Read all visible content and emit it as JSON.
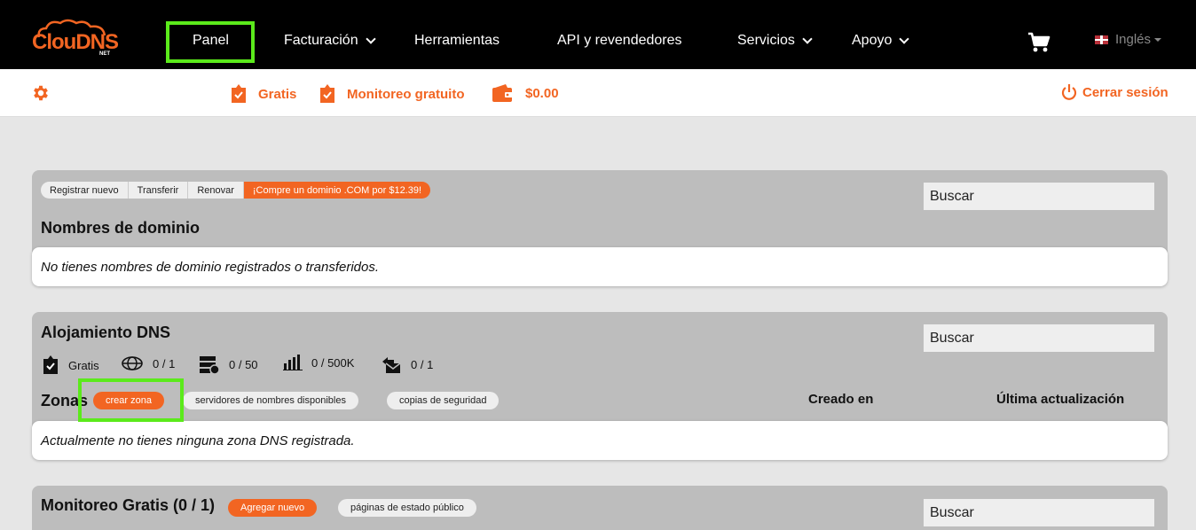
{
  "brand": {
    "logo_text": "ClouDNS",
    "logo_sub": "NET",
    "accent": "#f26522",
    "highlight": "#5bea1b"
  },
  "nav": {
    "items": [
      {
        "label": "Panel",
        "dropdown": false
      },
      {
        "label": "Facturación",
        "dropdown": true
      },
      {
        "label": "Herramientas",
        "dropdown": false
      },
      {
        "label": "API y revendedores",
        "dropdown": false
      },
      {
        "label": "Servicios",
        "dropdown": true
      },
      {
        "label": "Apoyo",
        "dropdown": true
      }
    ],
    "language": "Inglés",
    "cart_icon": "cart-icon"
  },
  "subbar": {
    "settings_icon": "gear-icon",
    "plan": "Gratis",
    "monitoring": "Monitoreo gratuito",
    "balance": "$0.00",
    "logout": "Cerrar sesión"
  },
  "domains": {
    "buttons": [
      "Registrar nuevo",
      "Transferir",
      "Renovar",
      "¡Compre un dominio .COM por $12.39!"
    ],
    "title": "Nombres de dominio",
    "search_placeholder": "Buscar",
    "empty_message": "No tienes nombres de dominio registrados o transferidos."
  },
  "dns": {
    "title": "Alojamiento DNS",
    "search_placeholder": "Buscar",
    "stats": [
      {
        "icon": "tag-check-icon",
        "value": "Gratis"
      },
      {
        "icon": "globe-icon",
        "value": "0 / 1"
      },
      {
        "icon": "server-globe-icon",
        "value": "0 / 50"
      },
      {
        "icon": "bar-chart-icon",
        "value": "0 / 500K"
      },
      {
        "icon": "mail-transfer-icon",
        "value": "0 / 1"
      }
    ],
    "zones_label": "Zonas",
    "create_zone": "crear zona",
    "nameservers": "servidores de nombres disponibles",
    "backups": "copias de seguridad",
    "col_created": "Creado en",
    "col_updated": "Última actualización",
    "empty_message": "Actualmente no tienes ninguna zona DNS registrada."
  },
  "monitoring": {
    "title": "Monitoreo Gratis (0 / 1)",
    "add_new": "Agregar nuevo",
    "status_pages": "páginas de estado público",
    "search_placeholder": "Buscar"
  }
}
